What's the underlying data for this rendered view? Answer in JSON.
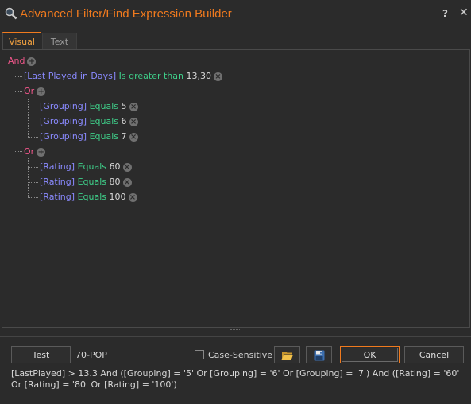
{
  "window": {
    "title": "Advanced Filter/Find Expression Builder",
    "help_label": "?",
    "close_label": "✕"
  },
  "tabs": [
    {
      "label": "Visual",
      "active": true
    },
    {
      "label": "Text",
      "active": false
    }
  ],
  "tree": {
    "root_op": "And",
    "rule1": {
      "field": "[Last Played in Days]",
      "op": "Is greater than",
      "value": "13,30"
    },
    "group1": {
      "op": "Or",
      "rules": [
        {
          "field": "[Grouping]",
          "op": "Equals",
          "value": "5"
        },
        {
          "field": "[Grouping]",
          "op": "Equals",
          "value": "6"
        },
        {
          "field": "[Grouping]",
          "op": "Equals",
          "value": "7"
        }
      ]
    },
    "group2": {
      "op": "Or",
      "rules": [
        {
          "field": "[Rating]",
          "op": "Equals",
          "value": "60"
        },
        {
          "field": "[Rating]",
          "op": "Equals",
          "value": "80"
        },
        {
          "field": "[Rating]",
          "op": "Equals",
          "value": "100"
        }
      ]
    }
  },
  "footer": {
    "test_label": "Test",
    "test_result": "70-POP",
    "case_sensitive_label": "Case-Sensitive",
    "case_sensitive_checked": false,
    "ok_label": "OK",
    "cancel_label": "Cancel",
    "expression": "[LastPlayed] > 13.3 And ([Grouping] = '5' Or [Grouping] = '6' Or [Grouping] = '7') And ([Rating] = '60' Or [Rating] = '80' Or [Rating] = '100')"
  },
  "icons": {
    "add": "plus-circle-icon",
    "remove": "x-circle-icon",
    "open": "folder-open-icon",
    "save": "floppy-disk-icon",
    "title": "magnifier-icon"
  },
  "colors": {
    "accent": "#f07a1e",
    "logic_op": "#f0568a",
    "field": "#8a8aff",
    "operator": "#3fd08a"
  }
}
